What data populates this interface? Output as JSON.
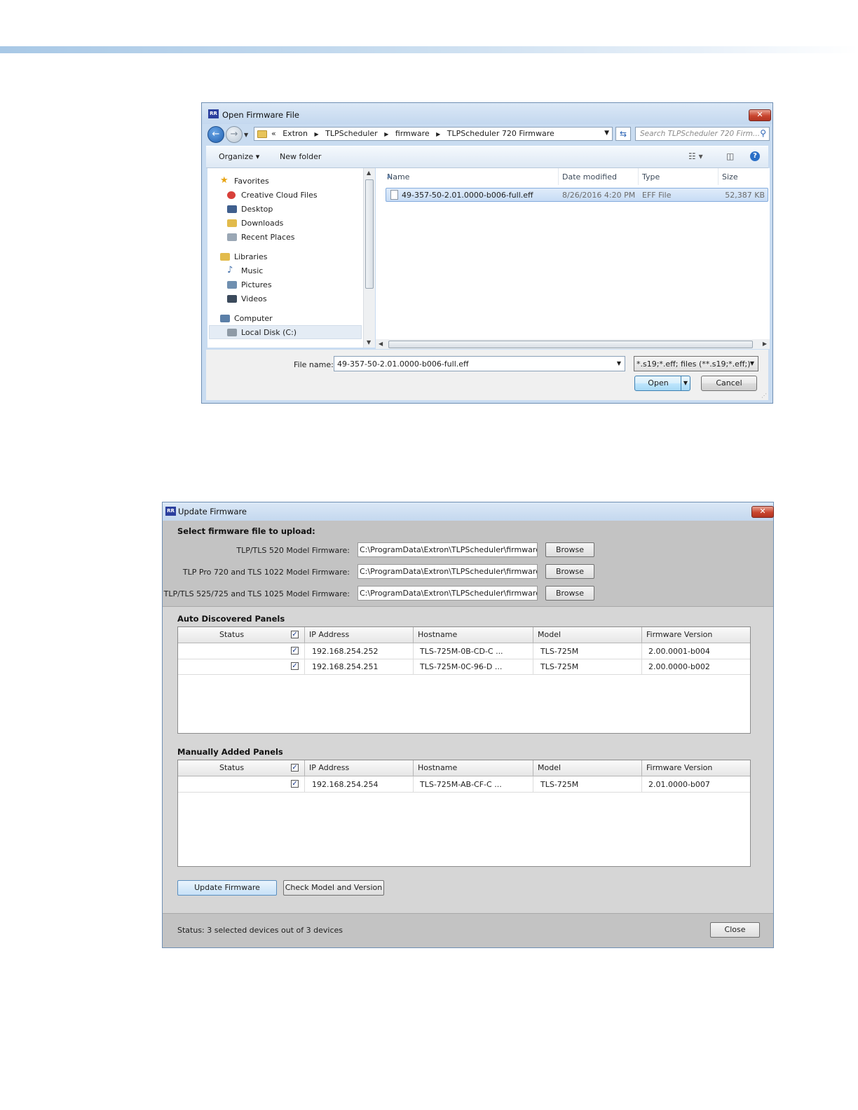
{
  "open_dialog": {
    "title": "Open Firmware File",
    "app_icon_text": "RR",
    "close_glyph": "✕",
    "breadcrumb_prefix": "«",
    "breadcrumbs": [
      "Extron",
      "TLPScheduler",
      "firmware",
      "TLPScheduler 720 Firmware"
    ],
    "search_placeholder": "Search TLPScheduler 720 Firm...",
    "toolbar": {
      "organize": "Organize ▾",
      "new_folder": "New folder"
    },
    "nav": {
      "favorites": "Favorites",
      "creative_cloud": "Creative Cloud Files",
      "desktop": "Desktop",
      "downloads": "Downloads",
      "recent_places": "Recent Places",
      "libraries": "Libraries",
      "music": "Music",
      "pictures": "Pictures",
      "videos": "Videos",
      "computer": "Computer",
      "local_disk": "Local Disk (C:)"
    },
    "columns": {
      "name": "Name",
      "date_modified": "Date modified",
      "type": "Type",
      "size": "Size"
    },
    "file": {
      "name": "49-357-50-2.01.0000-b006-full.eff",
      "date_modified": "8/26/2016 4:20 PM",
      "type": "EFF File",
      "size": "52,387 KB"
    },
    "file_name_label": "File name:",
    "file_name_value": "49-357-50-2.01.0000-b006-full.eff",
    "filter_value": "*.s19;*.eff; files (**.s19;*.eff;)",
    "open_label": "Open",
    "cancel_label": "Cancel",
    "icons": {
      "back": "back-arrow-icon",
      "forward": "forward-arrow-icon",
      "search": "search-icon",
      "help": "help-icon"
    }
  },
  "update_dialog": {
    "title": "Update Firmware",
    "app_icon_text": "RR",
    "close_glyph": "✕",
    "select_heading": "Select firmware file to upload:",
    "firmware_rows": [
      {
        "label": "TLP/TLS 520 Model Firmware:",
        "path": "C:\\ProgramData\\Extron\\TLPScheduler\\firmware\\TL",
        "button": "Browse"
      },
      {
        "label": "TLP Pro 720 and TLS 1022 Model Firmware:",
        "path": "C:\\ProgramData\\Extron\\TLPScheduler\\firmware\\TL",
        "button": "Browse"
      },
      {
        "label": "TLP/TLS 525/725 and TLS 1025 Model Firmware:",
        "path": "C:\\ProgramData\\Extron\\TLPScheduler\\firmware\\TL",
        "button": "Browse"
      }
    ],
    "grid_columns": {
      "status": "Status",
      "ip": "IP Address",
      "hostname": "Hostname",
      "model": "Model",
      "firmware": "Firmware Version"
    },
    "auto_heading": "Auto Discovered Panels",
    "auto_rows": [
      {
        "ip": "192.168.254.252",
        "hostname": "TLS-725M-0B-CD-C ...",
        "model": "TLS-725M",
        "firmware": "2.00.0001-b004",
        "checked": true
      },
      {
        "ip": "192.168.254.251",
        "hostname": "TLS-725M-0C-96-D ...",
        "model": "TLS-725M",
        "firmware": "2.00.0000-b002",
        "checked": true
      }
    ],
    "manual_heading": "Manually Added Panels",
    "manual_rows": [
      {
        "ip": "192.168.254.254",
        "hostname": "TLS-725M-AB-CF-C ...",
        "model": "TLS-725M",
        "firmware": "2.01.0000-b007",
        "checked": true
      }
    ],
    "update_button": "Update Firmware",
    "check_button": "Check Model and Version",
    "status_text": "Status: 3 selected devices out of 3 devices",
    "close_button": "Close",
    "check_glyph": "✓"
  }
}
